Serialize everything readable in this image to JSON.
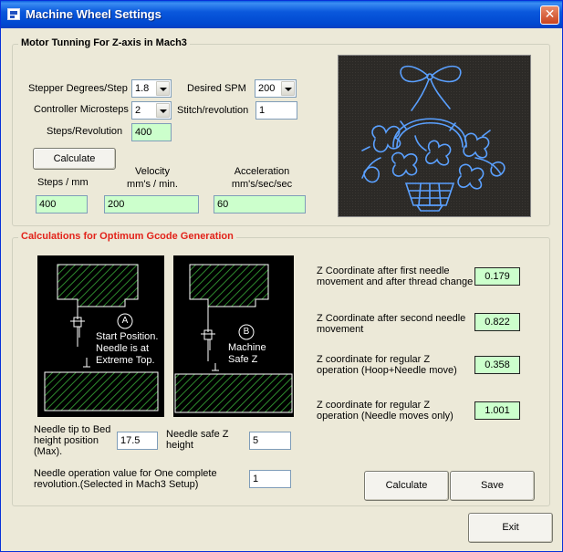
{
  "window": {
    "title": "Machine Wheel Settings",
    "close_glyph": "✕"
  },
  "motor": {
    "group_title": "Motor Tunning For Z-axis in Mach3",
    "stepper_degrees_label": "Stepper Degrees/Step",
    "stepper_degrees_value": "1.8",
    "desired_spm_label": "Desired SPM",
    "desired_spm_value": "200",
    "controller_microsteps_label": "Controller Microsteps",
    "controller_microsteps_value": "2",
    "stitch_rev_label": "Stitch/revolution",
    "stitch_rev_value": "1",
    "steps_rev_label": "Steps/Revolution",
    "steps_rev_value": "400",
    "calculate_label": "Calculate",
    "steps_mm_label": "Steps / mm",
    "steps_mm_value": "400",
    "velocity_label_1": "Velocity",
    "velocity_label_2": "mm's / min.",
    "velocity_value": "200",
    "accel_label_1": "Acceleration",
    "accel_label_2": "mm's/sec/sec",
    "accel_value": "60"
  },
  "gcode": {
    "group_title": "Calculations for Optimum Gcode Generation",
    "diagram_a": {
      "marker": "A",
      "line1": "Start Position.",
      "line2": "Needle is at",
      "line3": "Extreme Top."
    },
    "diagram_b": {
      "marker": "B",
      "line1": "Machine",
      "line2": "Safe Z"
    },
    "needle_tip_label": "Needle tip to Bed height position (Max).",
    "needle_tip_value": "17.5",
    "needle_safe_label": "Needle safe Z height",
    "needle_safe_value": "5",
    "needle_op_label": "Needle operation value for One complete revolution.(Selected in Mach3 Setup)",
    "needle_op_value": "1",
    "results": [
      {
        "label": "Z Coordinate after first needle movement and after thread change",
        "value": "0.179"
      },
      {
        "label": "Z Coordinate after second  needle movement",
        "value": "0.822"
      },
      {
        "label": "Z coordinate for  regular  Z operation (Hoop+Needle move)",
        "value": "0.358"
      },
      {
        "label": "Z coordinate for  regular  Z operation (Needle moves only)",
        "value": "1.001"
      }
    ],
    "calculate_label": "Calculate",
    "save_label": "Save"
  },
  "footer": {
    "exit_label": "Exit"
  },
  "colors": {
    "title_bar": "#0A58DC",
    "group2_title": "#E2231A",
    "readonly_field": "#CCFFCC",
    "hatch": "#2E8B2E",
    "embroidery": "#5AA0FF"
  },
  "photo": {
    "subject": "blue embroidered basket with bow on dark fabric"
  }
}
